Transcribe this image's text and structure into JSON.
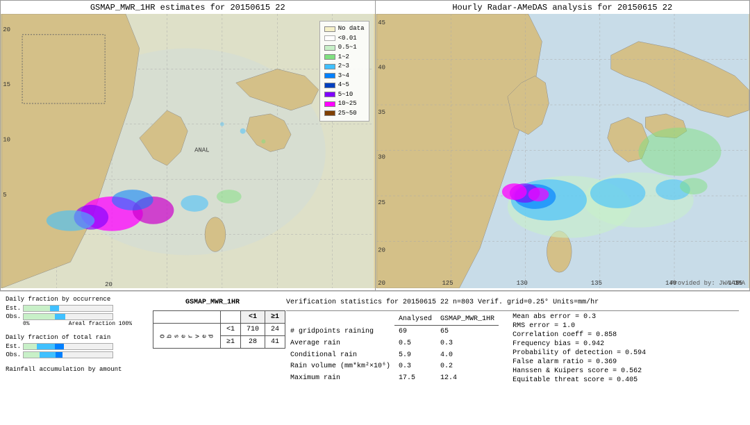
{
  "maps": {
    "left_title": "GSMAP_MWR_1HR estimates for 20150615 22",
    "right_title": "Hourly Radar-AMeDAS analysis for 20150615 22",
    "anal_label": "ANAL",
    "provided_label": "Provided by: JWA/JMA"
  },
  "legend": {
    "title": "",
    "items": [
      {
        "label": "No data",
        "color": "#f5f0c8"
      },
      {
        "label": "<0.01",
        "color": "#ffffff"
      },
      {
        "label": "0.5~1",
        "color": "#c8f0c8"
      },
      {
        "label": "1~2",
        "color": "#80e080"
      },
      {
        "label": "2~3",
        "color": "#40c0ff"
      },
      {
        "label": "3~4",
        "color": "#0080ff"
      },
      {
        "label": "4~5",
        "color": "#0040c0"
      },
      {
        "label": "5~10",
        "color": "#8000ff"
      },
      {
        "label": "10~25",
        "color": "#ff00ff"
      },
      {
        "label": "25~50",
        "color": "#804000"
      }
    ]
  },
  "charts": {
    "title1": "Daily fraction by occurrence",
    "title2": "Daily fraction of total rain",
    "title3": "Rainfall accumulation by amount",
    "est_label": "Est.",
    "obs_label": "Obs.",
    "axis_left": "0%",
    "axis_right": "Areal fraction 100%"
  },
  "contingency": {
    "title": "GSMAP_MWR_1HR",
    "col_header_lt1": "<1",
    "col_header_ge1": "≥1",
    "row_lt1_label": "<1",
    "row_ge1_label": "≥1",
    "cell_lt1_lt1": "710",
    "cell_lt1_ge1": "24",
    "cell_ge1_lt1": "28",
    "cell_ge1_ge1": "41",
    "obs_label": "O\nb\ns\ne\nr\nv\ne\nd"
  },
  "stats": {
    "title": "Verification statistics for 20150615 22  n=803  Verif. grid=0.25°  Units=mm/hr",
    "col_header1": "Analysed",
    "col_header2": "GSMAP_MWR_1HR",
    "rows": [
      {
        "label": "# gridpoints raining",
        "val1": "69",
        "val2": "65"
      },
      {
        "label": "Average rain",
        "val1": "0.5",
        "val2": "0.3"
      },
      {
        "label": "Conditional rain",
        "val1": "5.9",
        "val2": "4.0"
      },
      {
        "label": "Rain volume (mm*km²×10⁶)",
        "val1": "0.3",
        "val2": "0.2"
      },
      {
        "label": "Maximum rain",
        "val1": "17.5",
        "val2": "12.4"
      }
    ],
    "right_stats": [
      "Mean abs error = 0.3",
      "RMS error = 1.0",
      "Correlation coeff = 0.858",
      "Frequency bias = 0.942",
      "Probability of detection = 0.594",
      "False alarm ratio = 0.369",
      "Hanssen & Kuipers score = 0.562",
      "Equitable threat score = 0.405"
    ]
  },
  "left_map": {
    "axis_y": [
      "20",
      "15",
      "10",
      "5"
    ],
    "axis_x": [
      "20",
      "ANAL"
    ]
  },
  "right_map": {
    "axis_y": [
      "45",
      "40",
      "35",
      "30",
      "25",
      "20"
    ],
    "axis_x": [
      "125",
      "130",
      "135",
      "140",
      "145"
    ],
    "corner_labels": [
      "20",
      "25"
    ]
  }
}
